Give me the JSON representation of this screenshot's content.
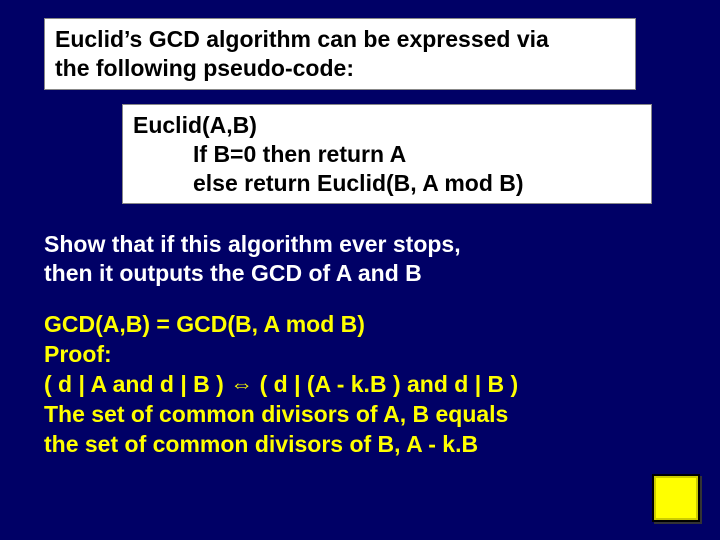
{
  "intro": {
    "line1": "Euclid’s GCD algorithm can be expressed via",
    "line2": "the following pseudo-code:"
  },
  "pseudocode": {
    "line1": "Euclid(A,B)",
    "line2": "If B=0 then return A",
    "line3": "else return Euclid(B, A mod B)"
  },
  "show": {
    "line1": "Show that if this algorithm ever stops,",
    "line2": "then it outputs the GCD of A and B"
  },
  "proof": {
    "line1": "GCD(A,B) = GCD(B, A mod B)",
    "line2": "Proof:",
    "line3": "( d | A and d | B ) ⇔ ( d | (A - k.B ) and d | B )",
    "line4": "The set of common divisors of A, B equals",
    "line5": "the set of common divisors of B, A - k.B"
  }
}
